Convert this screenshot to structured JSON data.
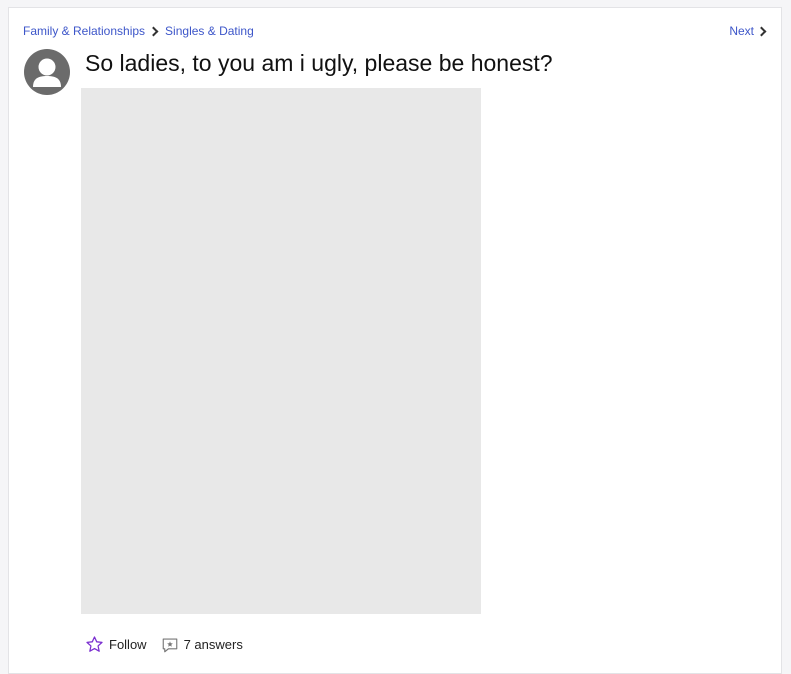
{
  "breadcrumb": {
    "category": "Family & Relationships",
    "subcategory": "Singles & Dating"
  },
  "nav": {
    "next_label": "Next"
  },
  "question": {
    "title": "So ladies, to you am i ugly, please be honest?"
  },
  "actions": {
    "follow_label": "Follow",
    "answers_label": "7 answers"
  },
  "colors": {
    "link": "#3d56c9",
    "follow_star": "#7b2fd0",
    "avatar": "#6b6b6b",
    "image_placeholder": "#e8e8e8"
  },
  "icons": {
    "breadcrumb_separator": "chevron-right-icon",
    "next": "chevron-right-icon",
    "follow": "star-outline-icon",
    "answers": "comment-star-icon",
    "avatar": "user-silhouette-icon"
  }
}
